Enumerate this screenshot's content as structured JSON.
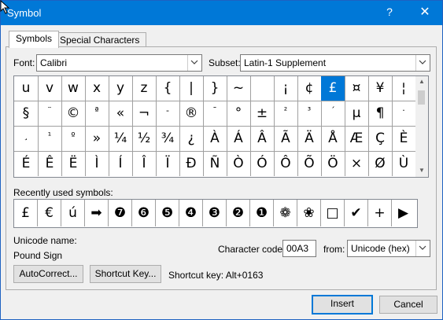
{
  "window": {
    "title": "Symbol",
    "help_glyph": "?",
    "close_glyph": "✕"
  },
  "tabs": [
    {
      "label": "Symbols"
    },
    {
      "label": "Special Characters"
    }
  ],
  "font": {
    "label": "Font:",
    "value": "Calibri"
  },
  "subset": {
    "label": "Subset:",
    "value": "Latin-1 Supplement"
  },
  "symbols": [
    [
      "u",
      "v",
      "w",
      "x",
      "y",
      "z",
      "{",
      "|",
      "}",
      "~",
      "",
      "¡",
      "¢",
      "£",
      "¤",
      "¥",
      "¦"
    ],
    [
      "§",
      "¨",
      "©",
      "ª",
      "«",
      "¬",
      "-",
      "®",
      "¯",
      "°",
      "±",
      "²",
      "³",
      "´",
      "µ",
      "¶",
      "·"
    ],
    [
      "¸",
      "¹",
      "º",
      "»",
      "¼",
      "½",
      "¾",
      "¿",
      "À",
      "Á",
      "Â",
      "Ã",
      "Ä",
      "Å",
      "Æ",
      "Ç",
      "È"
    ],
    [
      "É",
      "Ê",
      "Ë",
      "Ì",
      "Í",
      "Î",
      "Ï",
      "Ð",
      "Ñ",
      "Ò",
      "Ó",
      "Ô",
      "Õ",
      "Ö",
      "×",
      "Ø",
      "Ù"
    ]
  ],
  "selected_symbol": "£",
  "recent": {
    "label": "Recently used symbols:",
    "items": [
      "£",
      "€",
      "ú",
      "➡",
      "❼",
      "❻",
      "❺",
      "❹",
      "❸",
      "❷",
      "❶",
      "❁",
      "❀",
      "□",
      "✔",
      "+",
      "▶"
    ]
  },
  "unicode": {
    "name_label": "Unicode name:",
    "name_value": "Pound Sign"
  },
  "char_code": {
    "label": "Character code:",
    "value": "00A3"
  },
  "from": {
    "label": "from:",
    "value": "Unicode (hex)"
  },
  "buttons": {
    "autocorrect": "AutoCorrect...",
    "shortcut_key": "Shortcut Key...",
    "insert": "Insert",
    "cancel": "Cancel"
  },
  "shortcut_text": "Shortcut key: Alt+0163",
  "colors": {
    "accent": "#0078d7",
    "titlebar": "#0078d7"
  }
}
